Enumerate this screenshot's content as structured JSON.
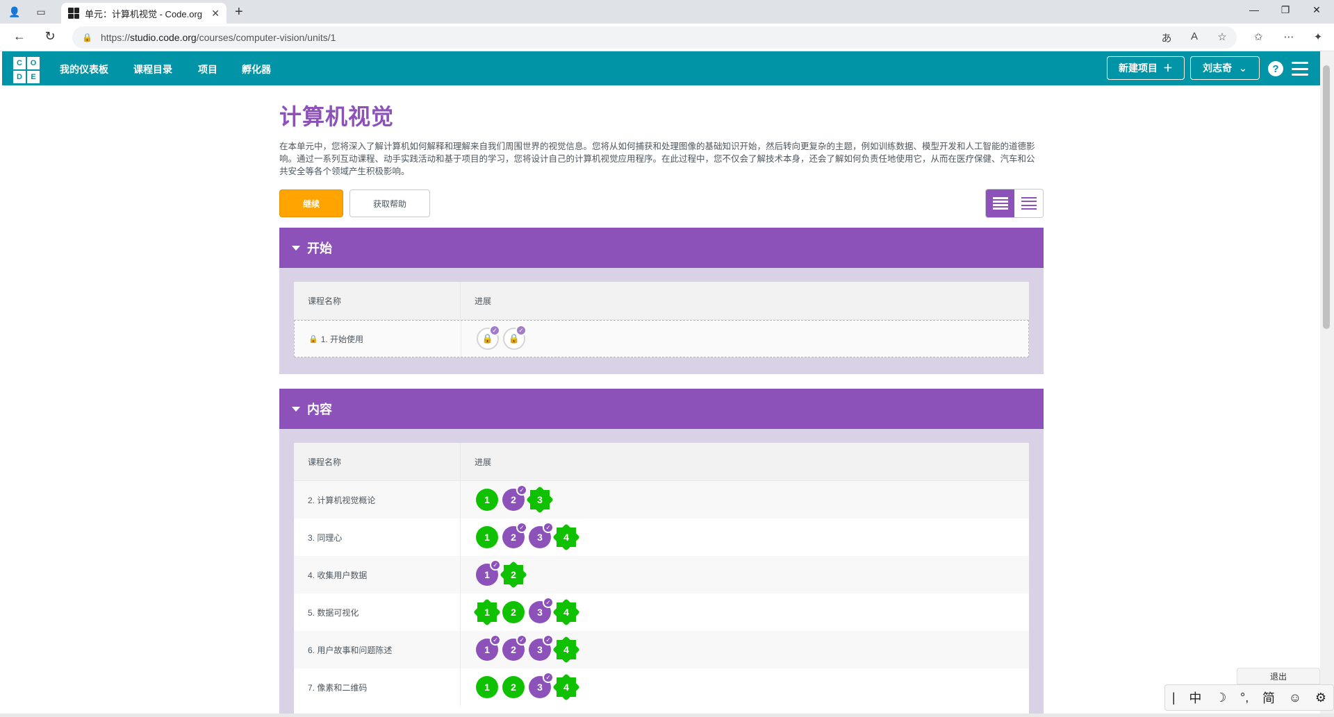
{
  "browser": {
    "tab_title": "单元：计算机视觉 - Code.org",
    "url_scheme": "https://",
    "url_host": "studio.code.org",
    "url_path": "/courses/computer-vision/units/1"
  },
  "header": {
    "logo_letters": [
      "C",
      "O",
      "D",
      "E"
    ],
    "nav": [
      "我的仪表板",
      "课程目录",
      "项目",
      "孵化器"
    ],
    "new_project": "新建项目",
    "user_name": "刘志奇",
    "help": "?"
  },
  "unit": {
    "title": "计算机视觉",
    "description": "在本单元中，您将深入了解计算机如何解释和理解来自我们周围世界的视觉信息。您将从如何捕获和处理图像的基础知识开始，然后转向更复杂的主题，例如训练数据、模型开发和人工智能的道德影响。通过一系列互动课程、动手实践活动和基于项目的学习，您将设计自己的计算机视觉应用程序。在此过程中，您不仅会了解技术本身，还会了解如何负责任地使用它，从而在医疗保健、汽车和公共安全等各个领域产生积极影响。",
    "continue_label": "继续",
    "help_label": "获取帮助"
  },
  "sections": [
    {
      "title": "开始",
      "col_name": "课程名称",
      "col_progress": "进展",
      "lessons": [
        {
          "name": "1. 开始使用",
          "locked": true,
          "bubbles": [
            {
              "type": "lock",
              "checked": true
            },
            {
              "type": "lock",
              "checked": true
            }
          ]
        }
      ]
    },
    {
      "title": "内容",
      "col_name": "课程名称",
      "col_progress": "进展",
      "lessons": [
        {
          "name": "2. 计算机视觉概论",
          "bubbles": [
            {
              "label": "1",
              "shape": "circle",
              "color": "done"
            },
            {
              "label": "2",
              "shape": "circle",
              "color": "assess",
              "checked": true
            },
            {
              "label": "3",
              "shape": "diamond",
              "color": "done"
            }
          ]
        },
        {
          "name": "3. 同理心",
          "bubbles": [
            {
              "label": "1",
              "shape": "circle",
              "color": "done"
            },
            {
              "label": "2",
              "shape": "circle",
              "color": "assess",
              "checked": true
            },
            {
              "label": "3",
              "shape": "circle",
              "color": "assess",
              "checked": true
            },
            {
              "label": "4",
              "shape": "diamond",
              "color": "done"
            }
          ]
        },
        {
          "name": "4. 收集用户数据",
          "bubbles": [
            {
              "label": "1",
              "shape": "circle",
              "color": "assess",
              "checked": true
            },
            {
              "label": "2",
              "shape": "diamond",
              "color": "done"
            }
          ]
        },
        {
          "name": "5. 数据可视化",
          "bubbles": [
            {
              "label": "1",
              "shape": "diamond",
              "color": "done"
            },
            {
              "label": "2",
              "shape": "circle",
              "color": "done"
            },
            {
              "label": "3",
              "shape": "circle",
              "color": "assess",
              "checked": true
            },
            {
              "label": "4",
              "shape": "diamond",
              "color": "done"
            }
          ]
        },
        {
          "name": "6. 用户故事和问题陈述",
          "bubbles": [
            {
              "label": "1",
              "shape": "circle",
              "color": "assess",
              "checked": true
            },
            {
              "label": "2",
              "shape": "circle",
              "color": "assess",
              "checked": true
            },
            {
              "label": "3",
              "shape": "circle",
              "color": "assess",
              "checked": true
            },
            {
              "label": "4",
              "shape": "diamond",
              "color": "done"
            }
          ]
        },
        {
          "name": "7. 像素和二维码",
          "bubbles": [
            {
              "label": "1",
              "shape": "circle",
              "color": "done"
            },
            {
              "label": "2",
              "shape": "circle",
              "color": "done"
            },
            {
              "label": "3",
              "shape": "circle",
              "color": "assess",
              "checked": true
            },
            {
              "label": "4",
              "shape": "diamond",
              "color": "done"
            }
          ]
        }
      ]
    }
  ],
  "ime": {
    "exit": "退出",
    "items": [
      "中",
      "☽",
      "°,",
      "简",
      "☺",
      "⚙"
    ]
  },
  "colors": {
    "teal": "#0094a6",
    "purple": "#8c52ba",
    "green": "#0fc100",
    "orange": "#ffa400"
  }
}
